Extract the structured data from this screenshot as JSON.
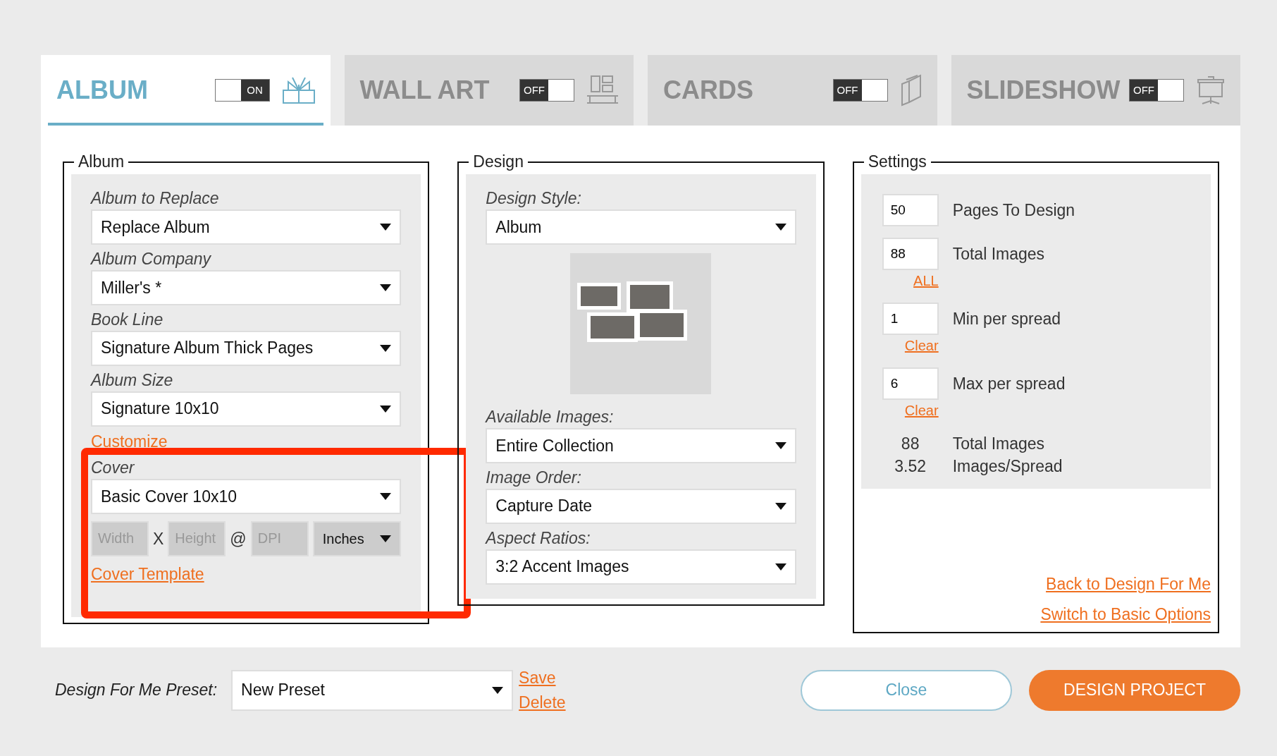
{
  "tabs": [
    {
      "label": "ALBUM",
      "switch_text": "ON",
      "on": true,
      "selected": true
    },
    {
      "label": "WALL ART",
      "switch_text": "OFF",
      "on": false,
      "selected": false
    },
    {
      "label": "CARDS",
      "switch_text": "OFF",
      "on": false,
      "selected": false
    },
    {
      "label": "SLIDESHOW",
      "switch_text": "OFF",
      "on": false,
      "selected": false
    }
  ],
  "album": {
    "title": "Album",
    "fields": [
      {
        "label": "Album to Replace",
        "value": "Replace Album"
      },
      {
        "label": "Album Company",
        "value": "Miller's *"
      },
      {
        "label": "Book Line",
        "value": "Signature Album Thick Pages"
      },
      {
        "label": "Album Size",
        "value": "Signature 10x10"
      }
    ],
    "customize_link": "Customize",
    "cover": {
      "label": "Cover",
      "value": "Basic Cover 10x10",
      "width_placeholder": "Width",
      "times": "X",
      "height_placeholder": "Height",
      "at": "@",
      "dpi_placeholder": "DPI",
      "unit": "Inches",
      "link": "Cover Template",
      "highlighted": true
    }
  },
  "design": {
    "title": "Design",
    "style": {
      "label": "Design Style:",
      "value": "Album"
    },
    "fields": [
      {
        "label": "Available Images:",
        "value": "Entire Collection"
      },
      {
        "label": "Image Order:",
        "value": "Capture Date"
      },
      {
        "label": "Aspect Ratios:",
        "value": "3:2 Accent Images"
      }
    ]
  },
  "settings": {
    "title": "Settings",
    "rows": [
      {
        "value": "50",
        "label": "Pages To Design"
      },
      {
        "value": "88",
        "label": "Total Images",
        "link": "ALL"
      },
      {
        "value": "1",
        "label": "Min per spread",
        "link": "Clear"
      },
      {
        "value": "6",
        "label": "Max per spread",
        "link": "Clear"
      }
    ],
    "summary": [
      {
        "value": "88",
        "label": "Total Images"
      },
      {
        "value": "3.52",
        "label": "Images/Spread"
      }
    ]
  },
  "side_links": [
    "Back to Design For Me",
    "Switch to Basic Options"
  ],
  "footer": {
    "preset_label": "Design For Me Preset:",
    "preset_value": "New Preset",
    "save": "Save",
    "delete": "Delete",
    "close": "Close",
    "design": "DESIGN PROJECT"
  }
}
